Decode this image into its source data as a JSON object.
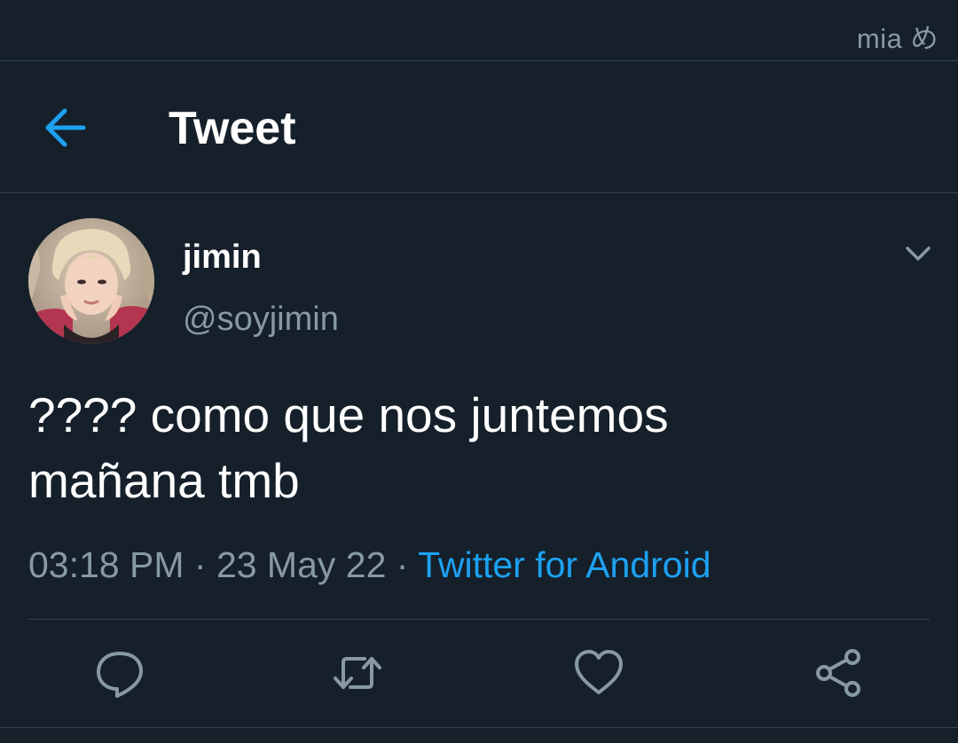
{
  "status_bar": {
    "text": "mia め"
  },
  "header": {
    "back_icon": "arrow-left-icon",
    "title": "Tweet",
    "accent_color": "#1da1f2"
  },
  "tweet": {
    "author": {
      "display_name": "jimin",
      "handle": "@soyjimin"
    },
    "text_line1": "???? como que nos juntemos",
    "text_line2": "mañana tmb",
    "time": "03:18 PM",
    "separator": " · ",
    "date": "23 May 22",
    "source": "Twitter for Android"
  },
  "actions": [
    {
      "icon": "reply-icon"
    },
    {
      "icon": "retweet-icon"
    },
    {
      "icon": "like-icon"
    },
    {
      "icon": "share-icon"
    }
  ],
  "colors": {
    "background": "#15202b",
    "secondary_text": "#8899a6",
    "divider": "#38444d",
    "link": "#1da1f2"
  }
}
